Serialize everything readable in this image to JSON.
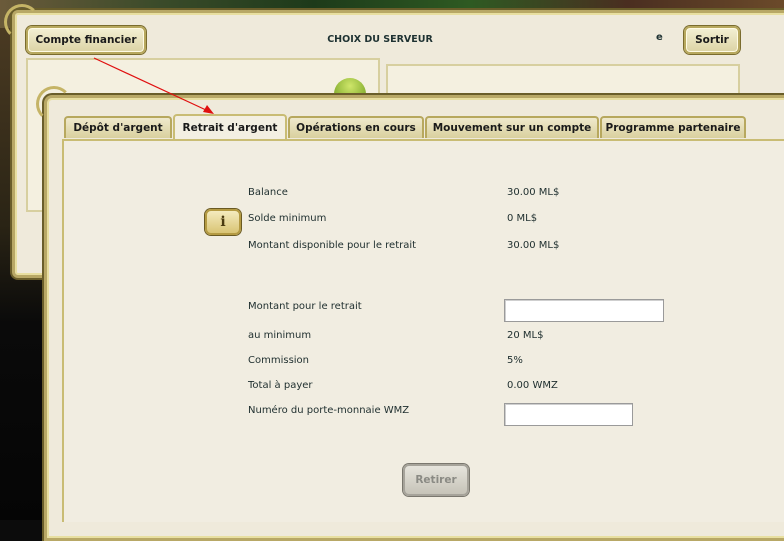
{
  "header": {
    "account_button": "Compte financier",
    "server_title": "CHOIX DU SERVEUR",
    "letter": "e",
    "exit_button": "Sortir"
  },
  "tabs": [
    {
      "label": "Dépôt d'argent",
      "active": false
    },
    {
      "label": "Retrait d'argent",
      "active": true
    },
    {
      "label": "Opérations en cours",
      "active": false
    },
    {
      "label": "Mouvement sur un compte",
      "active": false
    },
    {
      "label": "Programme partenaire",
      "active": false
    }
  ],
  "info_icon": "info-icon",
  "summary": {
    "balance_label": "Balance",
    "balance_value": "30.00 ML$",
    "min_balance_label": "Solde minimum",
    "min_balance_value": "0 ML$",
    "available_label": "Montant disponible pour le retrait",
    "available_value": "30.00 ML$"
  },
  "form": {
    "amount_label": "Montant pour le retrait",
    "amount_value": "",
    "minimum_label": "au minimum",
    "minimum_value": "20 ML$",
    "commission_label": "Commission",
    "commission_value": "5%",
    "total_label": "Total à payer",
    "total_value": "0.00 WMZ",
    "purse_label": "Numéro du porte-monnaie WMZ",
    "purse_value": ""
  },
  "submit_button": "Retirer",
  "colors": {
    "panel": "#efeadb",
    "gold_border": "#b8a866",
    "arrow": "#e01010"
  }
}
